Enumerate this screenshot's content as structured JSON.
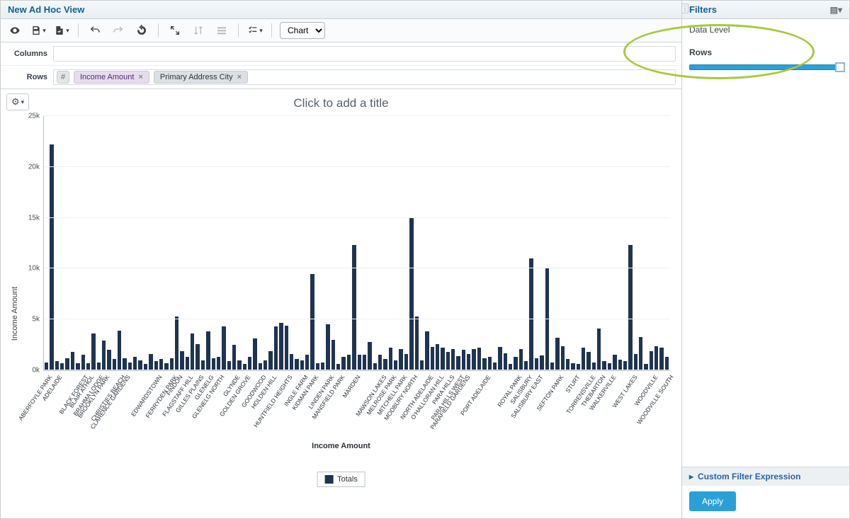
{
  "header": {
    "title": "New Ad Hoc View"
  },
  "sidebar": {
    "title": "Filters",
    "data_level_label": "Data Level",
    "rows_label": "Rows",
    "cfe_label": "Custom Filter Expression",
    "apply_label": "Apply"
  },
  "toolbar": {
    "view_mode_label": "Chart"
  },
  "fields": {
    "columns_label": "Columns",
    "rows_label": "Rows",
    "row_pills": [
      "Income Amount",
      "Primary Address City"
    ]
  },
  "chart": {
    "title_placeholder": "Click to add a title",
    "legend_label": "Totals"
  },
  "chart_data": {
    "type": "bar",
    "title": "",
    "xlabel": "Income Amount",
    "ylabel": "Income Amount",
    "ylim": [
      0,
      25000
    ],
    "yticks": [
      "0k",
      "5k",
      "10k",
      "15k",
      "20k",
      "25k"
    ],
    "series": [
      {
        "name": "Totals",
        "values": [
          800,
          22200,
          900,
          700,
          1200,
          1800,
          700,
          1500,
          700,
          3600,
          800,
          2900,
          2000,
          1100,
          3900,
          1200,
          800,
          1300,
          1000,
          600,
          1600,
          900,
          1100,
          700,
          1200,
          5300,
          1900,
          1300,
          3600,
          2600,
          1000,
          3800,
          1200,
          1300,
          4300,
          900,
          2500,
          1000,
          600,
          1300,
          3100,
          700,
          1000,
          1900,
          4300,
          4700,
          4400,
          1600,
          1100,
          1000,
          1500,
          9500,
          700,
          800,
          4500,
          3000,
          600,
          1300,
          1500,
          12300,
          1500,
          1500,
          2800,
          700,
          1500,
          1100,
          2200,
          1000,
          2100,
          1600,
          15000,
          5300,
          1000,
          3800,
          2300,
          2600,
          2200,
          1800,
          2100,
          1400,
          2000,
          1600,
          2100,
          2200,
          1200,
          1300,
          800,
          2300,
          1700,
          600,
          1300,
          2100,
          920,
          11000,
          1200,
          1450,
          10000,
          800,
          3200,
          2400,
          1100,
          700,
          600,
          2200,
          1800,
          800,
          4100,
          900,
          700,
          1500,
          1050,
          900,
          12300,
          1600,
          3300,
          600,
          1900,
          2400,
          2200,
          1300
        ]
      }
    ],
    "categories": [
      "ABERFOYLE PARK",
      "",
      "ADELAIDE",
      "",
      "",
      "",
      "",
      "BLACK FOREST",
      "BLAIR ATHOL",
      "",
      "BRAHMA LODGE",
      "BROOKLYN PARK",
      "",
      "",
      "CHRISTIES BEACH",
      "CLARENCE GARDENS",
      "",
      "",
      "",
      "",
      "",
      "EDWARDSTOWN",
      "",
      "",
      "FERRYDEN PARK",
      "FINDON",
      "",
      "FLAGSTAFF HILL",
      "",
      "GILLES PLAINS",
      "",
      "GLENELG",
      "",
      "GLENELG NORTH",
      "",
      "",
      "GLYNDE",
      "",
      "GOLDEN GROVE",
      "",
      "",
      "GOODWOOD",
      "",
      "HOLDEN HILL",
      "",
      "",
      "HUNTFIELD HEIGHTS",
      "",
      "",
      "INGLE FARM",
      "",
      "KIDMAN PARK",
      "",
      "",
      "LINDEN PARK",
      "",
      "MANSFIELD PARK",
      "",
      "",
      "MARDEN",
      "",
      "",
      "",
      "",
      "MAWSON LAKES",
      "",
      "MELROSE PARK",
      "",
      "MITCHELL PARK",
      "",
      "MODBURY NORTH",
      "",
      "",
      "NORTH ADELAIDE",
      "",
      "O'HALLORAN HILL",
      "",
      "PARA HILLS",
      "",
      "PARA HILLS WEST",
      "PARAFIELD GARDENS",
      "",
      "",
      "",
      "PORT ADELAIDE",
      "",
      "",
      "",
      "",
      "",
      "ROYAL PARK",
      "",
      "SALISBURY",
      "",
      "SALISBURY EAST",
      "",
      "",
      "",
      "SEFTON PARK",
      "",
      "",
      "STURT",
      "",
      "",
      "TORRENSVILLE",
      "",
      "THEBARTON",
      "",
      "WALKERVILLE",
      "",
      "",
      "",
      "WEST LAKES",
      "",
      "",
      "",
      "WOODVILLE",
      "",
      "",
      "WOODVILLE SOUTH"
    ]
  }
}
